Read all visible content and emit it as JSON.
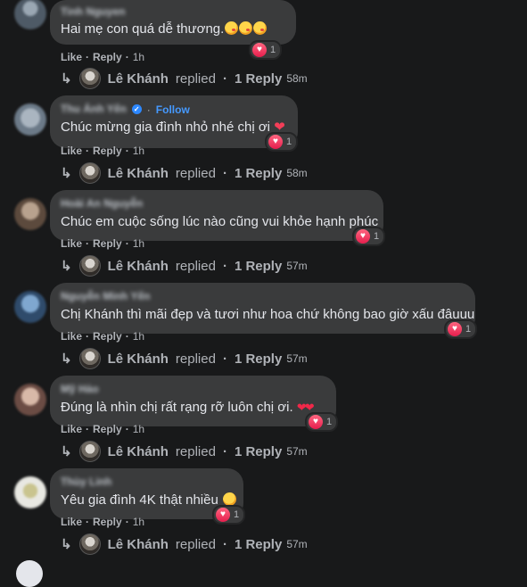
{
  "comments": [
    {
      "author": "Tinh Nguyen",
      "text": "Hai mẹ con quá dễ thương.",
      "emoji": [
        "kiss",
        "kiss",
        "kiss"
      ],
      "reaction_count": "1",
      "like": "Like",
      "reply": "Reply",
      "time": "1h",
      "replier": "Lê Khánh",
      "replied": "replied",
      "reply_count": "1 Reply",
      "reply_time": "58m"
    },
    {
      "author": "Thu Ánh Yến",
      "follow": "Follow",
      "text": "Chúc mừng gia đình nhỏ nhé chị ơi",
      "emoji": [
        "red-heart"
      ],
      "reaction_count": "1",
      "like": "Like",
      "reply": "Reply",
      "time": "1h",
      "replier": "Lê Khánh",
      "replied": "replied",
      "reply_count": "1 Reply",
      "reply_time": "58m"
    },
    {
      "author": "Hoài An Nguyễn",
      "text": "Chúc em cuộc sống lúc nào cũng vui khỏe hạnh phúc",
      "emoji": [],
      "reaction_count": "1",
      "like": "Like",
      "reply": "Reply",
      "time": "1h",
      "replier": "Lê Khánh",
      "replied": "replied",
      "reply_count": "1 Reply",
      "reply_time": "57m"
    },
    {
      "author": "Nguyễn Minh Yến",
      "text": "Chị Khánh thì mãi đẹp và tươi như hoa chứ không bao giờ xấu đâuuu",
      "emoji": [],
      "reaction_count": "1",
      "like": "Like",
      "reply": "Reply",
      "time": "1h",
      "replier": "Lê Khánh",
      "replied": "replied",
      "reply_count": "1 Reply",
      "reply_time": "57m"
    },
    {
      "author": "Mỹ Hảo",
      "text": "Đúng là nhìn chị rất rạng rỡ luôn chị ơi.",
      "emoji": [
        "two-hearts"
      ],
      "reaction_count": "1",
      "like": "Like",
      "reply": "Reply",
      "time": "1h",
      "replier": "Lê Khánh",
      "replied": "replied",
      "reply_count": "1 Reply",
      "reply_time": "57m"
    },
    {
      "author": "Thùy Linh",
      "text": "Yêu gia đình 4K thật nhiều",
      "emoji": [
        "smiling-face-with-hearts"
      ],
      "reaction_count": "1",
      "like": "Like",
      "reply": "Reply",
      "time": "1h",
      "replier": "Lê Khánh",
      "replied": "replied",
      "reply_count": "1 Reply",
      "reply_time": "57m"
    }
  ],
  "colors": {
    "background": "#18191a",
    "bubble": "#3a3b3c",
    "text": "#e4e6eb",
    "meta": "#b0b3b8",
    "link_blue": "#4599ff",
    "heart": "#f33e58"
  }
}
